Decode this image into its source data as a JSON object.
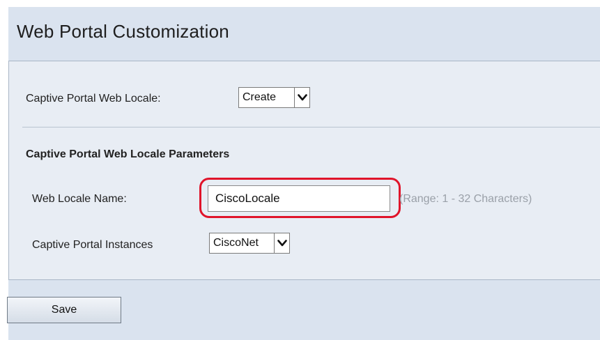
{
  "page": {
    "title": "Web Portal Customization"
  },
  "form": {
    "web_locale_label": "Captive Portal Web Locale:",
    "web_locale_value": "Create",
    "section_heading": "Captive Portal Web Locale Parameters",
    "locale_name_label": "Web Locale Name:",
    "locale_name_value": "CiscoLocale",
    "locale_name_hint": "(Range: 1 - 32 Characters)",
    "instances_label": "Captive Portal Instances",
    "instances_value": "CiscoNet"
  },
  "actions": {
    "save_label": "Save"
  },
  "colors": {
    "highlight": "#e0142a",
    "page_bg": "#dae3ef",
    "panel_bg": "#e8edf4"
  }
}
